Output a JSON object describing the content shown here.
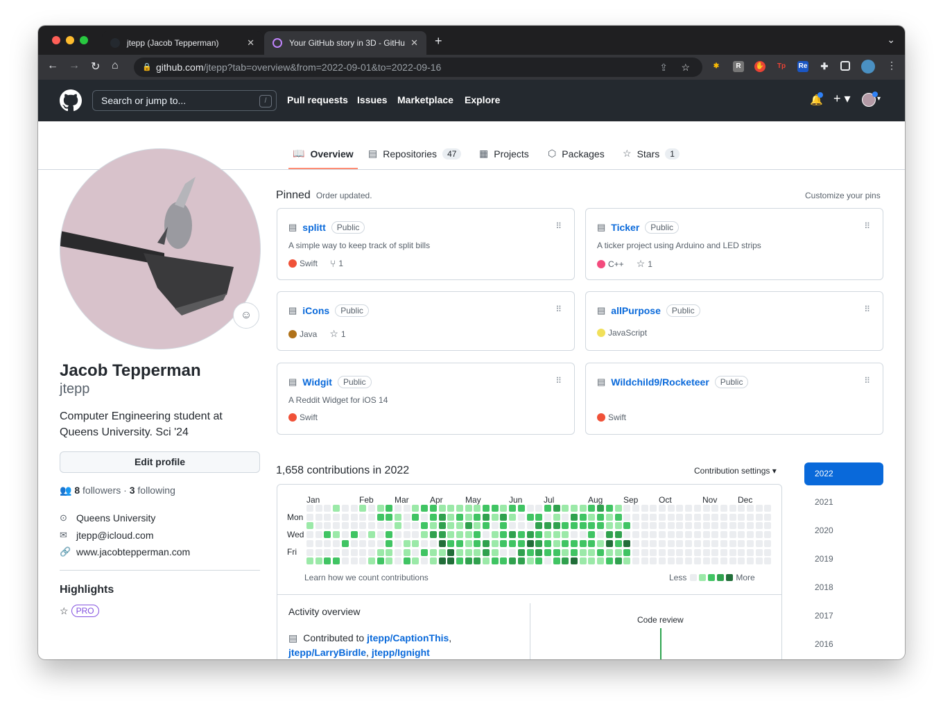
{
  "browser": {
    "tabs": [
      {
        "title": "jtepp (Jacob Tepperman)"
      },
      {
        "title": "Your GitHub story in 3D - GitHu"
      }
    ],
    "new_tab": "+",
    "tab_close": "✕",
    "url_host": "github.com",
    "url_path": "/jtepp?tab=overview&from=2022-09-01&to=2022-09-16"
  },
  "github": {
    "search_placeholder": "Search or jump to...",
    "search_key": "/",
    "nav": [
      "Pull requests",
      "Issues",
      "Marketplace",
      "Explore"
    ]
  },
  "profile_tabs": [
    {
      "label": "Overview",
      "count": ""
    },
    {
      "label": "Repositories",
      "count": "47"
    },
    {
      "label": "Projects",
      "count": ""
    },
    {
      "label": "Packages",
      "count": ""
    },
    {
      "label": "Stars",
      "count": "1"
    }
  ],
  "profile": {
    "name": "Jacob Tepperman",
    "login": "jtepp",
    "bio": "Computer Engineering student at Queens University. Sci '24",
    "edit_label": "Edit profile",
    "followers": "8",
    "followers_label": "followers",
    "following": "3",
    "following_label": "following",
    "location": "Queens University",
    "email": "jtepp@icloud.com",
    "website": "www.jacobtepperman.com",
    "highlights_title": "Highlights",
    "pro_badge": "PRO"
  },
  "pinned": {
    "title": "Pinned",
    "status": "Order updated.",
    "customize": "Customize your pins",
    "visibility": "Public",
    "repos": [
      {
        "name": "splitt",
        "desc": "A simple way to keep track of split bills",
        "lang": "Swift",
        "lang_color": "#F05138",
        "stat_icon": "fork",
        "stat": "1"
      },
      {
        "name": "Ticker",
        "desc": "A ticker project using Arduino and LED strips",
        "lang": "C++",
        "lang_color": "#f34b7d",
        "stat_icon": "star",
        "stat": "1"
      },
      {
        "name": "iCons",
        "desc": "",
        "lang": "Java",
        "lang_color": "#b07219",
        "stat_icon": "star",
        "stat": "1"
      },
      {
        "name": "allPurpose",
        "desc": "",
        "lang": "JavaScript",
        "lang_color": "#f1e05a",
        "stat_icon": "",
        "stat": ""
      },
      {
        "name": "Widgit",
        "desc": "A Reddit Widget for iOS 14",
        "lang": "Swift",
        "lang_color": "#F05138",
        "stat_icon": "",
        "stat": ""
      },
      {
        "name": "Wildchild9/Rocketeer",
        "desc": "",
        "lang": "Swift",
        "lang_color": "#F05138",
        "stat_icon": "",
        "stat": ""
      }
    ]
  },
  "contributions": {
    "title": "1,658 contributions in 2022",
    "settings": "Contribution settings ▾",
    "months": [
      "Jan",
      "Feb",
      "Mar",
      "Apr",
      "May",
      "Jun",
      "Jul",
      "Aug",
      "Sep",
      "Oct",
      "Nov",
      "Dec"
    ],
    "days": [
      "Mon",
      "Wed",
      "Fri"
    ],
    "learn": "Learn how we count contributions",
    "less": "Less",
    "more": "More",
    "colors": [
      "#ebedf0",
      "#9be9a8",
      "#40c463",
      "#30a14e",
      "#216e39"
    ],
    "weeks": 53,
    "active_through_week": 36
  },
  "activity": {
    "title": "Activity overview",
    "contributed_to": "Contributed to",
    "repos": [
      "jtepp/CaptionThis",
      "jtepp/LarryBirdle",
      "jtepp/Ignight"
    ],
    "code_review": "Code review"
  },
  "years": [
    "2022",
    "2021",
    "2020",
    "2019",
    "2018",
    "2017",
    "2016"
  ]
}
